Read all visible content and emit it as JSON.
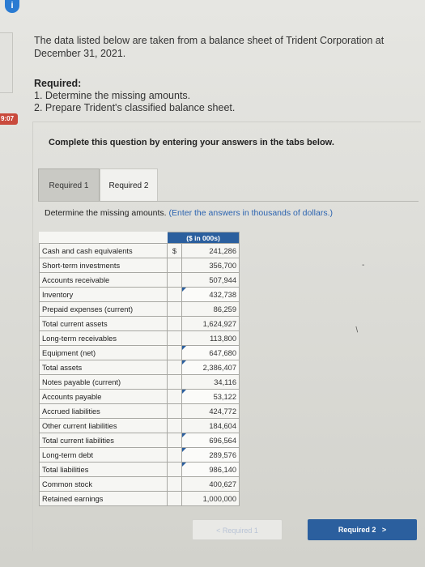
{
  "timer": "9:07",
  "intro": "The data listed below are taken from a balance sheet of Trident Corporation at December 31, 2021.",
  "required": {
    "heading": "Required:",
    "items": [
      "1. Determine the missing amounts.",
      "2. Prepare Trident's classified balance sheet."
    ]
  },
  "complete_text": "Complete this question by entering your answers in the tabs below.",
  "tabs": [
    "Required 1",
    "Required 2"
  ],
  "instruction": "Determine the missing amounts.",
  "hint": "(Enter the answers in thousands of dollars.)",
  "table": {
    "header": "($ in 000s)",
    "currency": "$",
    "rows": [
      {
        "label": "Cash and cash equivalents",
        "value": "241,286"
      },
      {
        "label": "Short-term investments",
        "value": "356,700"
      },
      {
        "label": "Accounts receivable",
        "value": "507,944"
      },
      {
        "label": "Inventory",
        "value": "432,738"
      },
      {
        "label": "Prepaid expenses (current)",
        "value": "86,259"
      },
      {
        "label": "Total current assets",
        "value": "1,624,927"
      },
      {
        "label": "Long-term receivables",
        "value": "113,800"
      },
      {
        "label": "Equipment (net)",
        "value": "647,680"
      },
      {
        "label": "Total assets",
        "value": "2,386,407"
      },
      {
        "label": "Notes payable (current)",
        "value": "34,116"
      },
      {
        "label": "Accounts payable",
        "value": "53,122"
      },
      {
        "label": "Accrued liabilities",
        "value": "424,772"
      },
      {
        "label": "Other current liabilities",
        "value": "184,604"
      },
      {
        "label": "Total current liabilities",
        "value": "696,564"
      },
      {
        "label": "Long-term debt",
        "value": "289,576"
      },
      {
        "label": "Total liabilities",
        "value": "986,140"
      },
      {
        "label": "Common stock",
        "value": "400,627"
      },
      {
        "label": "Retained earnings",
        "value": "1,000,000"
      }
    ]
  },
  "buttons": {
    "prev": "Required 1",
    "next": "Required 2"
  },
  "icons": {
    "info": "info-icon",
    "prev": "chevron-left-icon",
    "next": "chevron-right-icon"
  },
  "colors": {
    "accent": "#2b5f9e",
    "timer": "#c94a3c"
  }
}
